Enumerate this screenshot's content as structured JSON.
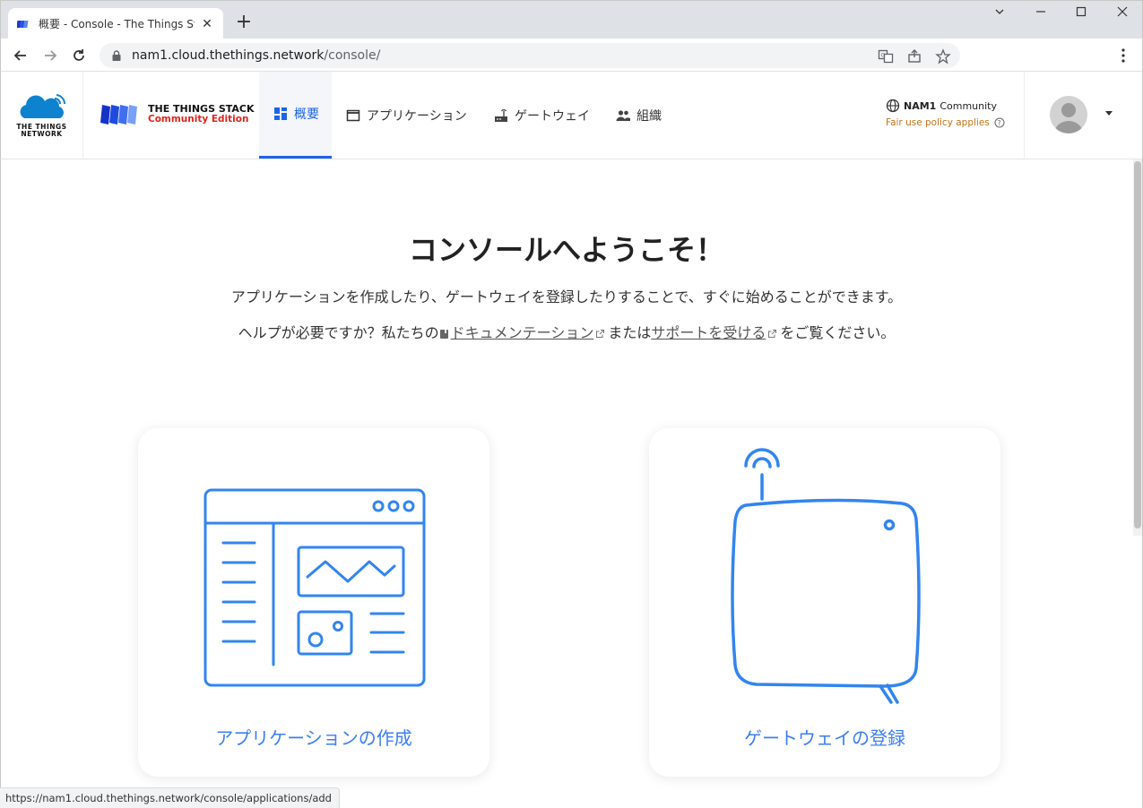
{
  "browser": {
    "tab_title": "概要 - Console - The Things Stack",
    "tab_close": "✕",
    "new_tab": "+",
    "url_host": "nam1.cloud.thethings.network",
    "url_path": "/console/",
    "status_url": "https://nam1.cloud.thethings.network/console/applications/add"
  },
  "header": {
    "ttn_logo_text": "THE THINGS NETWORK",
    "stack_title": "THE THINGS STACK",
    "stack_subtitle": "Community Edition",
    "nav": [
      {
        "label": "概要",
        "active": true
      },
      {
        "label": "アプリケーション"
      },
      {
        "label": "ゲートウェイ"
      },
      {
        "label": "組織"
      }
    ],
    "cluster": "NAM1",
    "cluster_type": "Community",
    "fair_use": "Fair use policy applies"
  },
  "main": {
    "title": "コンソールへようこそ！",
    "intro": "アプリケーションを作成したり、ゲートウェイを登録したりすることで、すぐに始めることができます。",
    "help_prefix": "ヘルプが必要ですか？私たちの",
    "docs_link": "ドキュメンテーション",
    "help_or": "または",
    "support_link": "サポートを受ける",
    "help_suffix": "をご覧ください。",
    "cards": [
      {
        "label": "アプリケーションの作成"
      },
      {
        "label": "ゲートウェイの登録"
      }
    ]
  },
  "colors": {
    "accent": "#1e62e6",
    "card_icon": "#3385ee",
    "card_label": "#3d7ef0",
    "fair_use": "#c0731a",
    "edition": "#e0231c"
  }
}
